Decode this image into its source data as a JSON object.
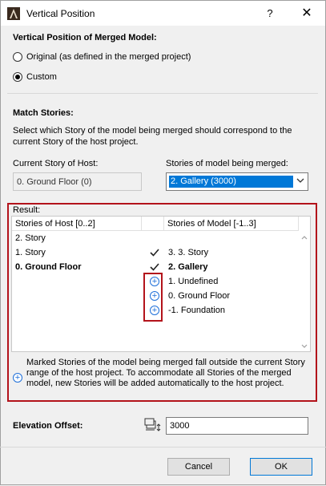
{
  "window": {
    "title": "Vertical Position",
    "help_label": "?",
    "close_label": "✕"
  },
  "vertical_position": {
    "heading": "Vertical Position of Merged Model:",
    "options": [
      {
        "label": "Original (as defined in the merged project)",
        "selected": false
      },
      {
        "label": "Custom",
        "selected": true
      }
    ]
  },
  "match_stories": {
    "heading": "Match Stories:",
    "description_line1": "Select which Story of the model being merged should correspond to the",
    "description_line2": "current Story of the host project.",
    "current_story_label": "Current Story of Host:",
    "current_story_value": "0. Ground Floor (0)",
    "model_stories_label": "Stories of model being merged:",
    "model_stories_value": "2. Gallery (3000)"
  },
  "result": {
    "label": "Result:",
    "col_host": "Stories of Host [0..2]",
    "col_model": "Stories of Model [-1..3]",
    "rows": [
      {
        "host": "2. Story",
        "mark": "",
        "model": "",
        "host_bold": false,
        "model_bold": false
      },
      {
        "host": "1. Story",
        "mark": "check",
        "model": "3. 3. Story",
        "host_bold": false,
        "model_bold": false
      },
      {
        "host": "0. Ground Floor",
        "mark": "check",
        "model": "2. Gallery",
        "host_bold": true,
        "model_bold": true
      },
      {
        "host": "",
        "mark": "plus",
        "model": "1. Undefined",
        "host_bold": false,
        "model_bold": false
      },
      {
        "host": "",
        "mark": "plus",
        "model": "0. Ground Floor",
        "host_bold": false,
        "model_bold": false
      },
      {
        "host": "",
        "mark": "plus",
        "model": "-1. Foundation",
        "host_bold": false,
        "model_bold": false
      }
    ],
    "note": "Marked Stories of the model being merged fall outside the current Story range of the host project. To accommodate all Stories of the merged model, new Stories will be added automatically to the host project."
  },
  "elevation": {
    "label": "Elevation Offset:",
    "value": "3000"
  },
  "buttons": {
    "cancel": "Cancel",
    "ok": "OK"
  },
  "colors": {
    "highlight_border": "#b3131b",
    "plus_blue": "#1e6fd9",
    "selection": "#0078d7"
  },
  "icons": [
    "archicad-app-icon",
    "checkmark-icon",
    "plus-circle-icon",
    "elevation-offset-icon",
    "chevron-down-icon"
  ]
}
